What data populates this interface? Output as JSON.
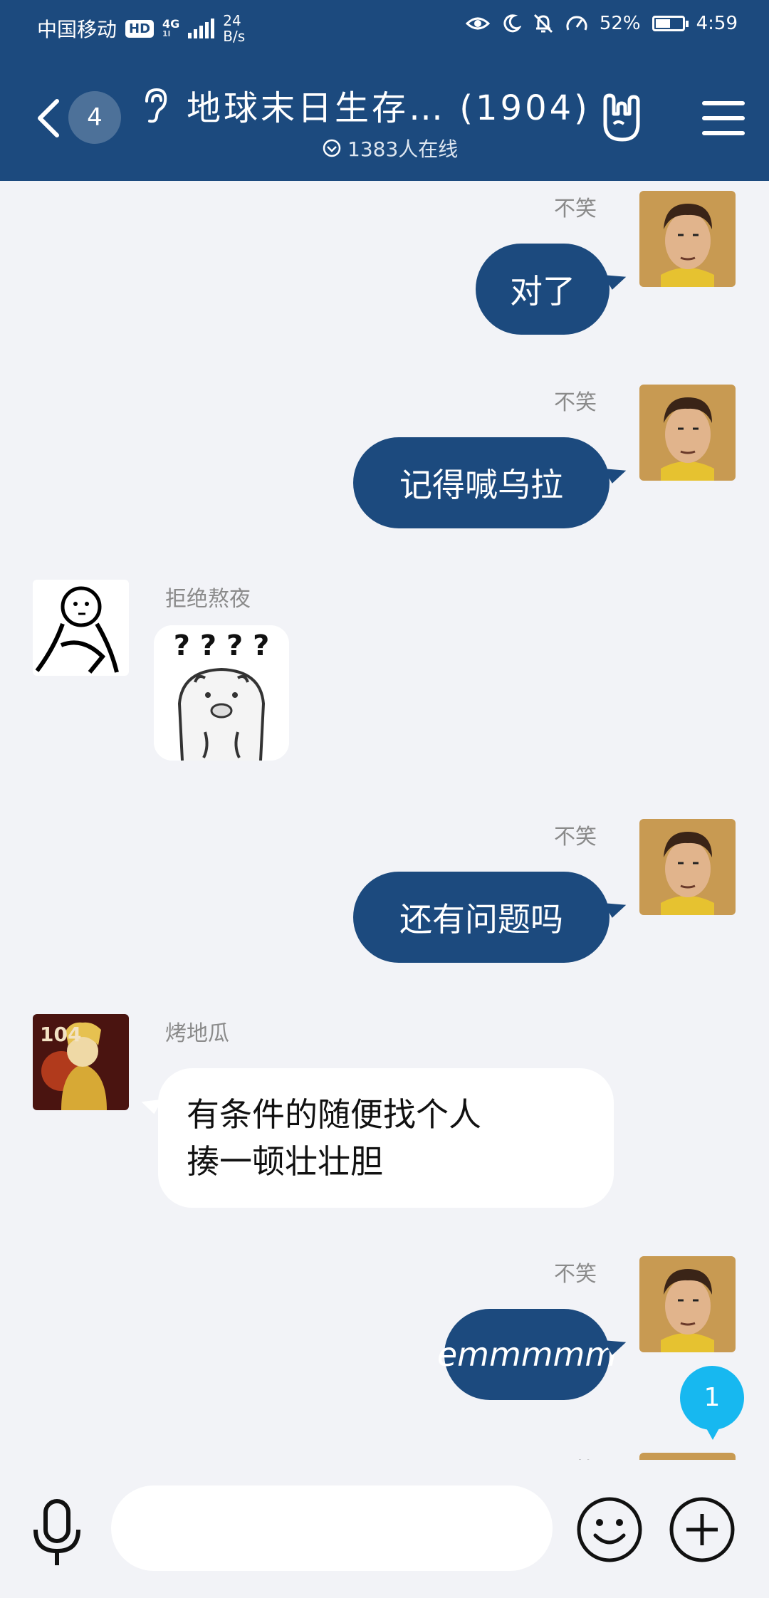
{
  "status_bar": {
    "carrier": "中国移动",
    "hd": "HD",
    "network": "4G",
    "network_sub": "1l",
    "speed_value": "24",
    "speed_unit": "B/s",
    "battery": "52%",
    "time": "4:59"
  },
  "header": {
    "unread_count": "4",
    "group_title": "地球末日生存… (1904)",
    "online_count": "1383人在线"
  },
  "messages": [
    {
      "sender": "不笑",
      "direction": "out",
      "text": "对了"
    },
    {
      "sender": "不笑",
      "direction": "out",
      "text": "记得喊乌拉"
    },
    {
      "sender": "拒绝熬夜",
      "direction": "in",
      "type": "sticker",
      "sticker_text": "? ? ? ?"
    },
    {
      "sender": "不笑",
      "direction": "out",
      "text": "还有问题吗"
    },
    {
      "sender": "烤地瓜",
      "direction": "in",
      "text_line1": "有条件的随便找个人",
      "text_line2": "揍一顿壮壮胆",
      "avatar_text": "104"
    },
    {
      "sender": "不笑",
      "direction": "out",
      "text": "emmmmm"
    },
    {
      "sender": "不笑",
      "direction": "out",
      "text": ""
    }
  ],
  "new_message_badge": "1",
  "input": {
    "placeholder": ""
  },
  "colors": {
    "primary": "#1c4a7e",
    "background": "#f2f3f7",
    "badge": "#17b8f0"
  }
}
